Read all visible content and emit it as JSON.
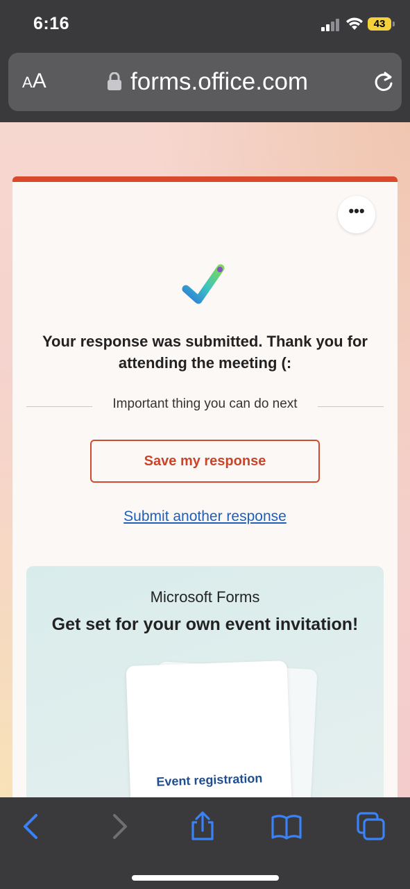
{
  "status_bar": {
    "time": "6:16",
    "battery_level": "43"
  },
  "browser": {
    "text_size_label_small": "A",
    "text_size_label_large": "A",
    "url": "forms.office.com"
  },
  "card": {
    "accent_color": "#d9492c",
    "more_label": "•••",
    "confirmation": "Your response was submitted. Thank you for attending the meeting (:",
    "next_steps_label": "Important thing you can do next",
    "save_button": "Save my response",
    "submit_another_link": "Submit another response"
  },
  "promo": {
    "brand": "Microsoft Forms",
    "title": "Get set for your own event invitation!",
    "invite_card_label": "Event registration"
  },
  "toolbar": {
    "icons": [
      "back-icon",
      "forward-icon",
      "share-icon",
      "bookmarks-icon",
      "tabs-icon"
    ],
    "icon_color": "#3a82f7"
  }
}
